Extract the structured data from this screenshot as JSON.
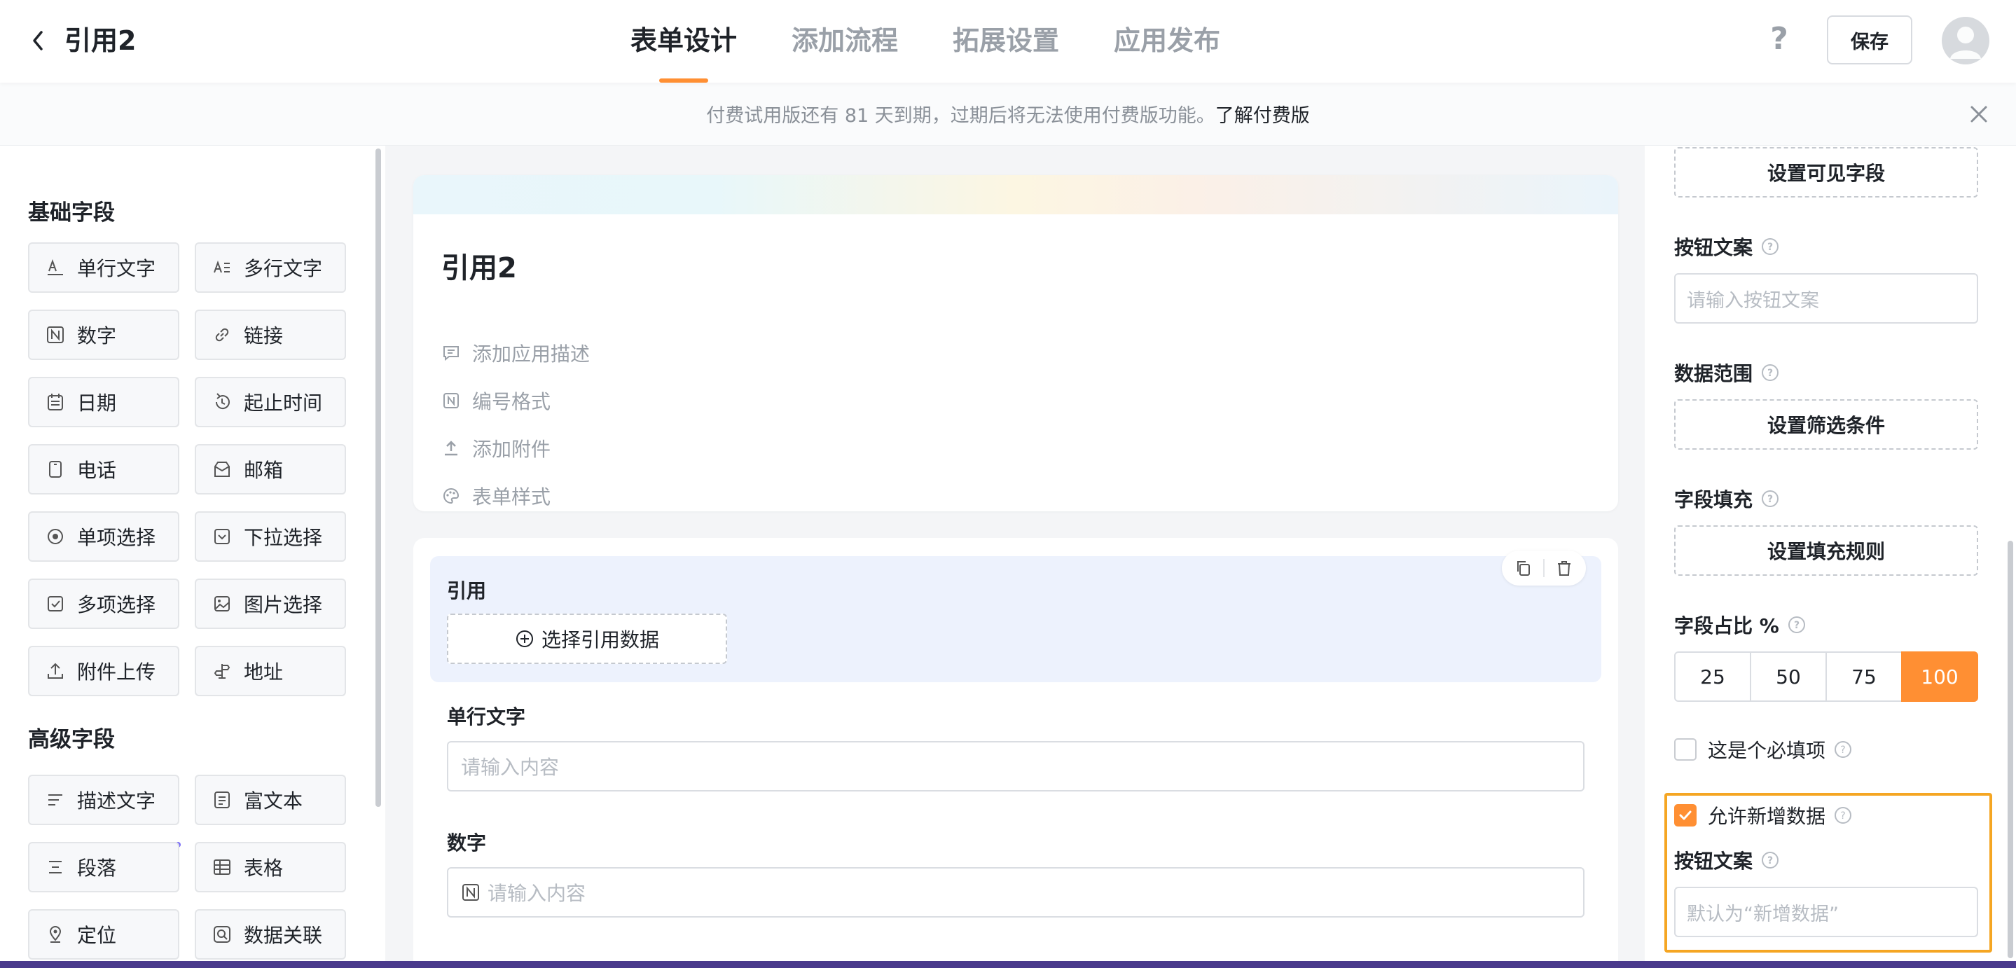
{
  "header": {
    "title": "引用2",
    "tabs": [
      {
        "label": "表单设计",
        "active": true
      },
      {
        "label": "添加流程",
        "active": false
      },
      {
        "label": "拓展设置",
        "active": false
      },
      {
        "label": "应用发布",
        "active": false
      }
    ],
    "help_label": "?",
    "save_label": "保存",
    "accent_color": "#ff8f33"
  },
  "notice": {
    "text": "付费试用版还有 81 天到期，过期后将无法使用付费版功能。",
    "link_text": "了解付费版"
  },
  "left_panel": {
    "basic_title": "基础字段",
    "basic_fields": [
      {
        "label": "单行文字",
        "icon": "single-line-text-icon"
      },
      {
        "label": "多行文字",
        "icon": "multi-line-text-icon"
      },
      {
        "label": "数字",
        "icon": "number-icon"
      },
      {
        "label": "链接",
        "icon": "link-icon"
      },
      {
        "label": "日期",
        "icon": "calendar-icon"
      },
      {
        "label": "起止时间",
        "icon": "time-range-icon"
      },
      {
        "label": "电话",
        "icon": "phone-icon"
      },
      {
        "label": "邮箱",
        "icon": "mail-icon"
      },
      {
        "label": "单项选择",
        "icon": "radio-icon"
      },
      {
        "label": "下拉选择",
        "icon": "dropdown-icon"
      },
      {
        "label": "多项选择",
        "icon": "checkbox-icon"
      },
      {
        "label": "图片选择",
        "icon": "image-icon"
      },
      {
        "label": "附件上传",
        "icon": "upload-icon"
      },
      {
        "label": "地址",
        "icon": "address-icon"
      }
    ],
    "advanced_title": "高级字段",
    "advanced_fields": [
      {
        "label": "描述文字",
        "icon": "description-icon"
      },
      {
        "label": "富文本",
        "icon": "rich-text-icon"
      },
      {
        "label": "段落",
        "icon": "paragraph-icon"
      },
      {
        "label": "表格",
        "icon": "table-icon"
      },
      {
        "label": "定位",
        "icon": "location-icon"
      },
      {
        "label": "数据关联",
        "icon": "data-link-icon"
      }
    ]
  },
  "form": {
    "name": "引用2",
    "options": [
      {
        "label": "添加应用描述",
        "icon": "comment-icon"
      },
      {
        "label": "编号格式",
        "icon": "number-format-icon"
      },
      {
        "label": "添加附件",
        "icon": "attachment-upload-icon"
      },
      {
        "label": "表单样式",
        "icon": "palette-icon"
      }
    ],
    "reference_field": {
      "label": "引用",
      "select_label": "选择引用数据"
    },
    "fields": [
      {
        "label": "单行文字",
        "placeholder": "请输入内容"
      },
      {
        "label": "数字",
        "placeholder": "请输入内容"
      }
    ]
  },
  "right_panel": {
    "visible_fields_button": "设置可见字段",
    "button_text_label": "按钮文案",
    "button_text_placeholder": "请输入按钮文案",
    "data_range_label": "数据范围",
    "filter_button": "设置筛选条件",
    "field_fill_label": "字段填充",
    "fill_rule_button": "设置填充规则",
    "ratio_label": "字段占比 %",
    "ratio_options": [
      "25",
      "50",
      "75",
      "100"
    ],
    "ratio_selected": "100",
    "required_label": "这是个必填项",
    "required_checked": false,
    "allow_new_label": "允许新增数据",
    "allow_new_checked": true,
    "new_button_text_label": "按钮文案",
    "new_button_placeholder": "默认为“新增数据”"
  }
}
